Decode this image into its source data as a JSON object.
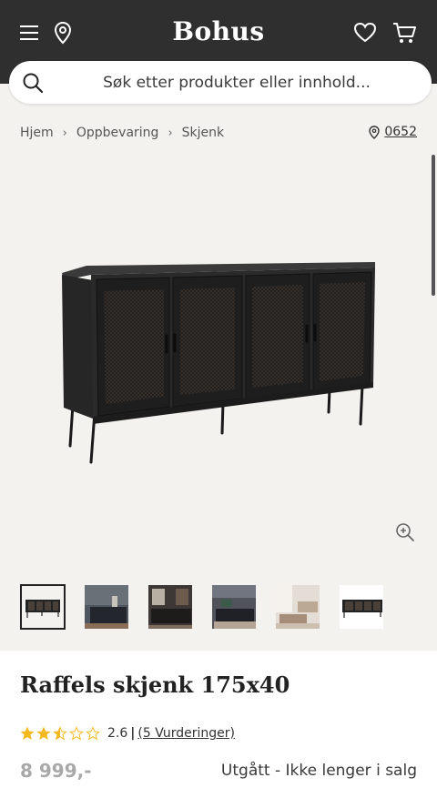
{
  "header": {
    "brand": "Bohus",
    "menu_icon": "hamburger-menu-icon",
    "location_icon": "location-pin-icon",
    "wishlist_icon": "heart-icon",
    "cart_icon": "shopping-cart-icon",
    "bg_color": "#2f2f30"
  },
  "search": {
    "placeholder": "Søk etter produkter eller innhold..."
  },
  "breadcrumb": {
    "items": [
      "Hjem",
      "Oppbevaring",
      "Skjenk"
    ]
  },
  "store": {
    "code": "0652"
  },
  "gallery": {
    "thumbnail_count": 6,
    "active_index": 0
  },
  "product": {
    "title": "Raffels skjenk 175x40",
    "rating_value": "2.6",
    "rating_count_text": "(5 Vurderinger)",
    "stars_filled": 2.5,
    "stars_total": 5,
    "price": "8 999,-",
    "status": "Utgått - Ikke lenger i salg"
  },
  "colors": {
    "star": "#f3b81c",
    "price_muted": "#a9a9a9"
  }
}
